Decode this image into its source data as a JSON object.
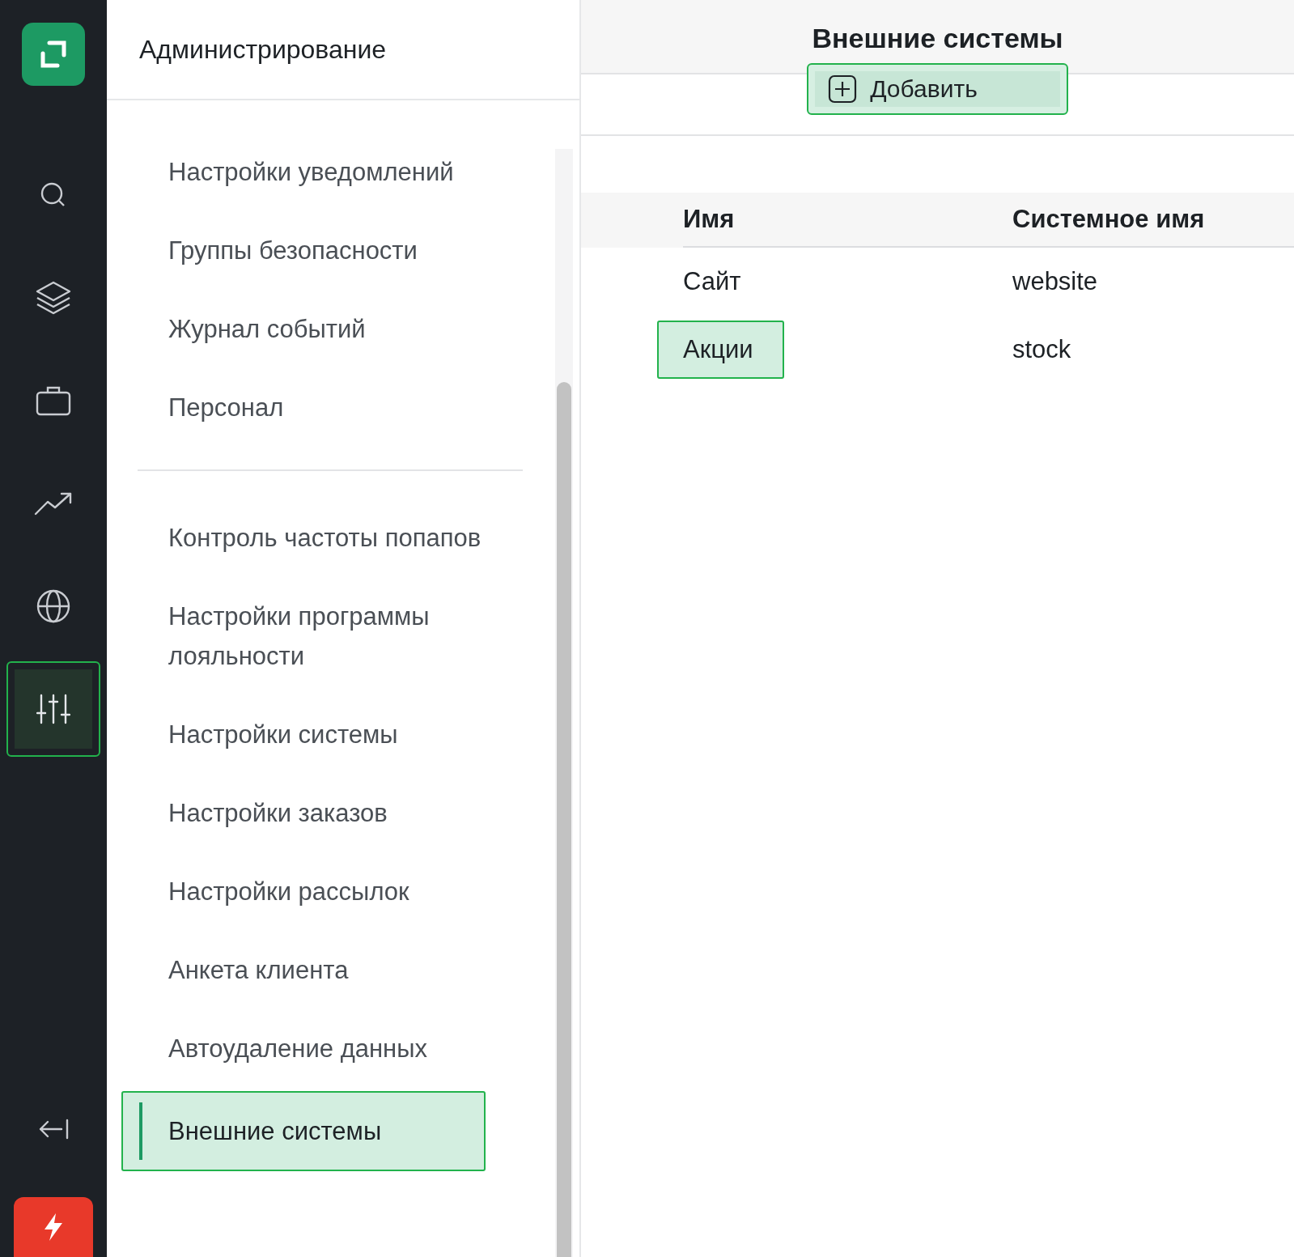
{
  "app_rail": {
    "items": [
      {
        "kind": "search",
        "selected": false
      },
      {
        "kind": "layers",
        "selected": false
      },
      {
        "kind": "briefcase",
        "selected": false
      },
      {
        "kind": "trend",
        "selected": false
      },
      {
        "kind": "globe",
        "selected": false
      },
      {
        "kind": "sliders",
        "selected": true
      }
    ]
  },
  "admin_panel": {
    "title": "Администрирование",
    "groups": [
      {
        "items": [
          {
            "label": "Настройки уведомлений",
            "selected": false
          },
          {
            "label": "Группы безопасности",
            "selected": false
          },
          {
            "label": "Журнал событий",
            "selected": false
          },
          {
            "label": "Персонал",
            "selected": false
          }
        ]
      },
      {
        "items": [
          {
            "label": "Контроль частоты попапов",
            "selected": false
          },
          {
            "label": "Настройки программы лояльности",
            "selected": false
          },
          {
            "label": "Настройки системы",
            "selected": false
          },
          {
            "label": "Настройки заказов",
            "selected": false
          },
          {
            "label": "Настройки рассылок",
            "selected": false
          },
          {
            "label": "Анкета клиента",
            "selected": false
          },
          {
            "label": "Автоудаление данных",
            "selected": false
          },
          {
            "label": "Внешние системы",
            "selected": true
          }
        ]
      }
    ]
  },
  "main": {
    "title": "Внешние системы",
    "add_button": {
      "label": "Добавить",
      "highlighted": true
    },
    "table": {
      "columns": [
        "Имя",
        "Системное имя"
      ],
      "rows": [
        {
          "name": "Сайт",
          "system_name": "website",
          "highlighted": false
        },
        {
          "name": "Акции",
          "system_name": "stock",
          "highlighted": true
        }
      ]
    }
  }
}
